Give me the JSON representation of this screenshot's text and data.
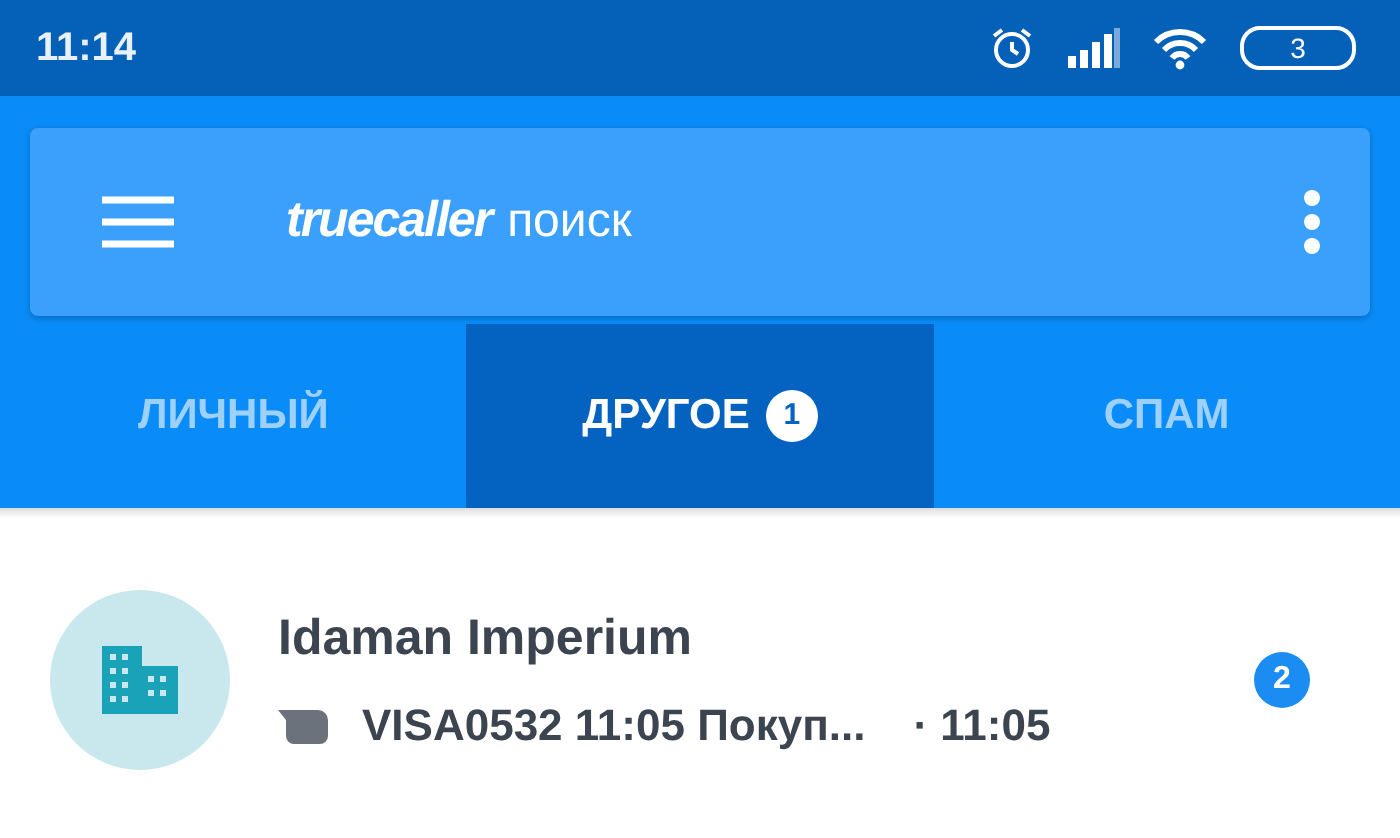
{
  "status_bar": {
    "time": "11:14",
    "battery": "3"
  },
  "search_bar": {
    "logo": "truecaller",
    "title": "поиск"
  },
  "tabs": [
    {
      "label": "ЛИЧНЫЙ",
      "selected": false
    },
    {
      "label": "ДРУГОЕ",
      "selected": true,
      "badge": "1"
    },
    {
      "label": "СПАМ",
      "selected": false
    }
  ],
  "conversations": [
    {
      "name": "Idaman Imperium",
      "snippet": "VISA0532 11:05 Покуп...",
      "time": "· 11:05",
      "unread": "2"
    }
  ]
}
